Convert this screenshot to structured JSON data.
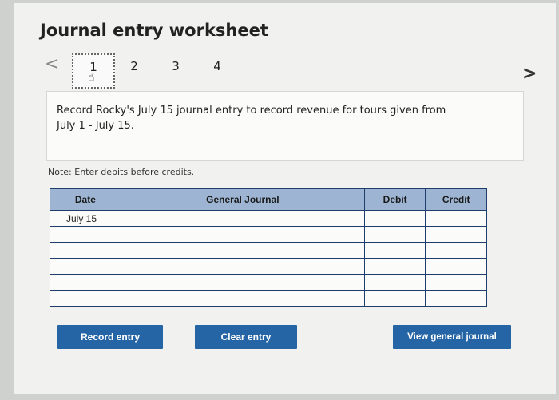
{
  "title": "Journal entry worksheet",
  "nav": {
    "prev_icon": "<",
    "next_icon": ">",
    "tabs": [
      "1",
      "2",
      "3",
      "4"
    ],
    "active_tab": "1"
  },
  "prompt": {
    "line1": "Record Rocky's July 15 journal entry to record revenue for tours given from",
    "line2": "July 1 - July 15."
  },
  "note": "Note: Enter debits before credits.",
  "table": {
    "headers": {
      "date": "Date",
      "journal": "General Journal",
      "debit": "Debit",
      "credit": "Credit"
    },
    "rows": [
      {
        "date": "July 15",
        "account": "",
        "debit": "",
        "credit": ""
      },
      {
        "date": "",
        "account": "",
        "debit": "",
        "credit": ""
      },
      {
        "date": "",
        "account": "",
        "debit": "",
        "credit": ""
      },
      {
        "date": "",
        "account": "",
        "debit": "",
        "credit": ""
      },
      {
        "date": "",
        "account": "",
        "debit": "",
        "credit": ""
      },
      {
        "date": "",
        "account": "",
        "debit": "",
        "credit": ""
      }
    ]
  },
  "buttons": {
    "record": "Record entry",
    "clear": "Clear entry",
    "view": "View general journal"
  },
  "colors": {
    "header_bg": "#9db5d3",
    "grid_border": "#1f3d6b",
    "button_bg": "#2565a6"
  }
}
